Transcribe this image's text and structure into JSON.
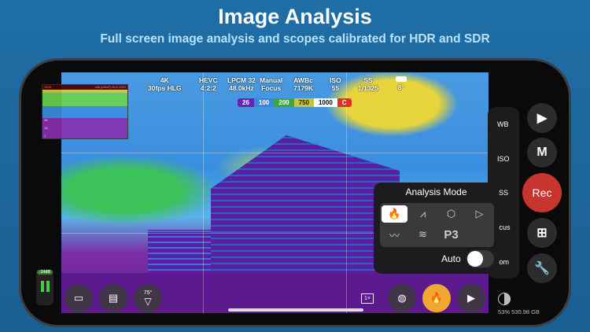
{
  "header": {
    "title": "Image Analysis",
    "subtitle": "Full screen image analysis and scopes calibrated for HDR and SDR"
  },
  "status": [
    {
      "top": "4K",
      "bottom": "30fps HLG"
    },
    {
      "top": "HEVC",
      "bottom": "4:2:2"
    },
    {
      "top": "LPCM 32",
      "bottom": "48.0kHz"
    },
    {
      "top": "Manual",
      "bottom": "Focus"
    },
    {
      "top": "AWBc",
      "bottom": "7179K"
    },
    {
      "top": "ISO",
      "bottom": "55"
    },
    {
      "top": "SS",
      "bottom": "1/1325"
    }
  ],
  "temperature": "8°",
  "legend": [
    {
      "label": "26",
      "color": "#6a22b0"
    },
    {
      "label": "100",
      "color": "#3b86d6"
    },
    {
      "label": "200",
      "color": "#3ca83c"
    },
    {
      "label": "750",
      "color": "#c8c23a"
    },
    {
      "label": "1000",
      "color": "#ffffff"
    },
    {
      "label": "C",
      "color": "#e0302a"
    }
  ],
  "scope": {
    "max": "1000",
    "title": "nits (cd/m²) HLG 2020",
    "ticks": [
      "26",
      "10",
      "1"
    ]
  },
  "controls": {
    "wb": "WB",
    "iso": "ISO",
    "ss": "SS",
    "focus": "Focus",
    "zoom": "Zoom"
  },
  "right": {
    "manual": "M",
    "rec": "Rec"
  },
  "panel": {
    "title": "Analysis Mode",
    "p3": "P3",
    "auto": "Auto",
    "auto_on": false
  },
  "audio": {
    "level": "-14dB"
  },
  "fov": "75°",
  "zoom_label": "1×",
  "storage": {
    "percent": "53%",
    "free": "530.98 GB"
  }
}
